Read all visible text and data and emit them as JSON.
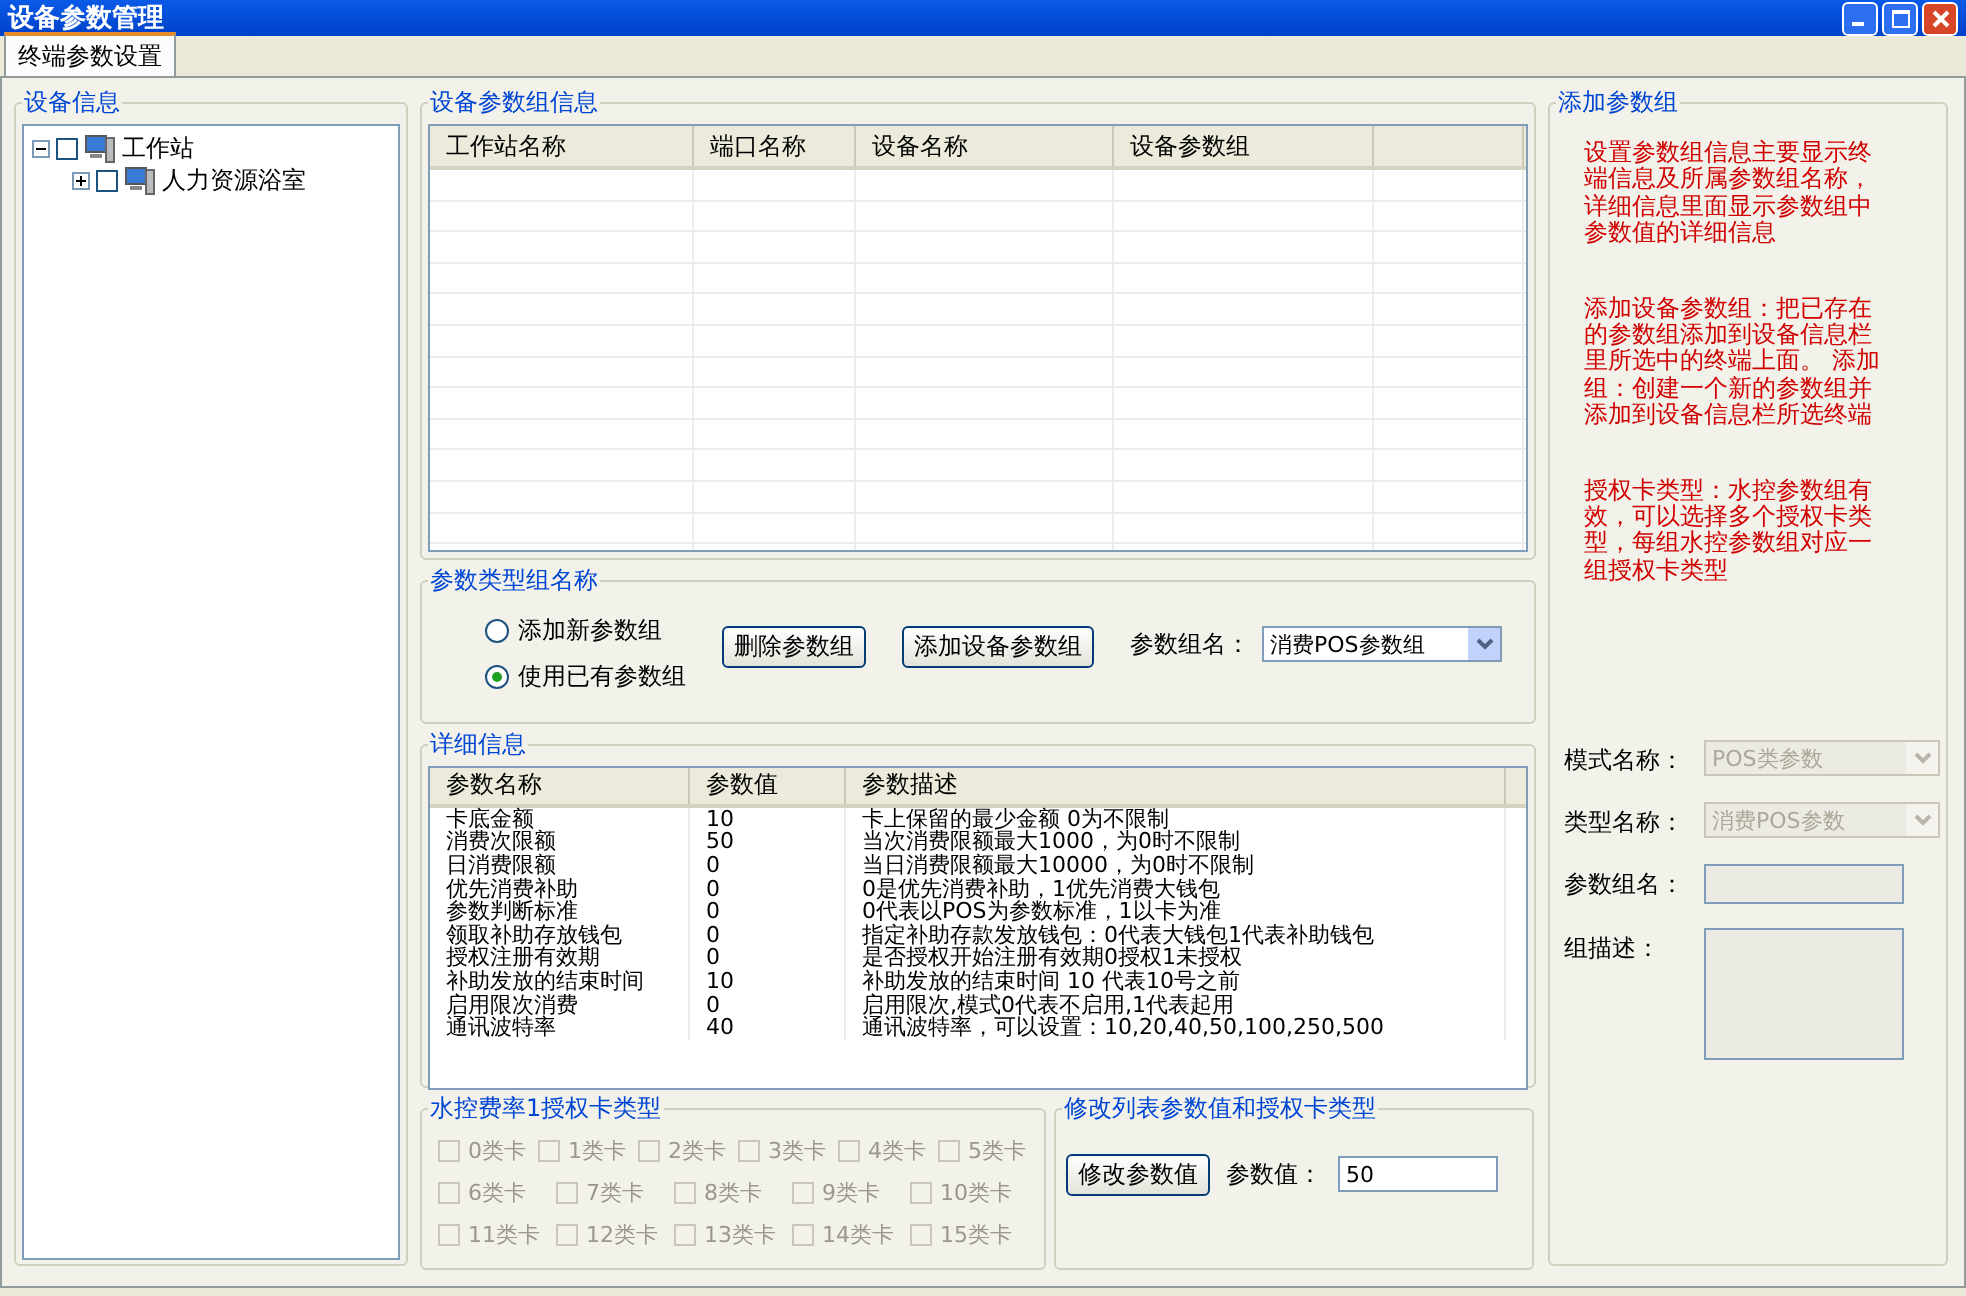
{
  "window": {
    "title": "设备参数管理"
  },
  "tabs": [
    {
      "label": "终端参数设置",
      "selected": true
    }
  ],
  "device_info": {
    "title": "设备信息",
    "tree": [
      {
        "label": "工作站",
        "expanded": true,
        "checked": false,
        "children": [
          {
            "label": "人力资源浴室",
            "expanded": false,
            "checked": false
          }
        ]
      }
    ]
  },
  "group_info": {
    "title": "设备参数组信息",
    "columns": [
      "工作站名称",
      "端口名称",
      "设备名称",
      "设备参数组"
    ]
  },
  "param_type": {
    "title": "参数类型组名称",
    "options": [
      {
        "label": "添加新参数组",
        "selected": false
      },
      {
        "label": "使用已有参数组",
        "selected": true
      }
    ],
    "buttons": [
      "删除参数组",
      "添加设备参数组"
    ],
    "group_label": "参数组名：",
    "group_value": "消费POS参数组"
  },
  "details": {
    "title": "详细信息",
    "columns": [
      "参数名称",
      "参数值",
      "参数描述"
    ],
    "rows": [
      {
        "name": "卡底金额",
        "value": "10",
        "description": "卡上保留的最少金额 0为不限制"
      },
      {
        "name": "消费次限额",
        "value": "50",
        "description": "当次消费限额最大1000，为0时不限制"
      },
      {
        "name": "日消费限额",
        "value": "0",
        "description": "当日消费限额最大10000，为0时不限制"
      },
      {
        "name": "优先消费补助",
        "value": "0",
        "description": "0是优先消费补助，1优先消费大钱包"
      },
      {
        "name": "参数判断标准",
        "value": "0",
        "description": "0代表以POS为参数标准，1以卡为准"
      },
      {
        "name": "领取补助存放钱包",
        "value": "0",
        "description": "指定补助存款发放钱包：0代表大钱包1代表补助钱包"
      },
      {
        "name": "授权注册有效期",
        "value": "0",
        "description": "是否授权开始注册有效期0授权1未授权"
      },
      {
        "name": "补助发放的结束时间",
        "value": "10",
        "description": "补助发放的结束时间 10 代表10号之前"
      },
      {
        "name": "启用限次消费",
        "value": "0",
        "description": "启用限次,模式0代表不启用,1代表起用"
      },
      {
        "name": "通讯波特率",
        "value": "40",
        "description": "通讯波特率，可以设置：10,20,40,50,100,250,500"
      }
    ]
  },
  "water_cards": {
    "title": "水控费率1授权卡类型",
    "disabled": true,
    "rows": [
      {
        "cards": [
          {
            "label": "0类卡",
            "checked": false
          },
          {
            "label": "1类卡",
            "checked": false
          },
          {
            "label": "2类卡",
            "checked": false
          },
          {
            "label": "3类卡",
            "checked": false
          },
          {
            "label": "4类卡",
            "checked": false
          },
          {
            "label": "5类卡",
            "checked": false
          }
        ]
      },
      {
        "cards": [
          {
            "label": "6类卡",
            "checked": false
          },
          {
            "label": "7类卡",
            "checked": false
          },
          {
            "label": "8类卡",
            "checked": false
          },
          {
            "label": "9类卡",
            "checked": false
          },
          {
            "label": "10类卡",
            "checked": false
          }
        ]
      },
      {
        "cards": [
          {
            "label": "11类卡",
            "checked": false
          },
          {
            "label": "12类卡",
            "checked": false
          },
          {
            "label": "13类卡",
            "checked": false
          },
          {
            "label": "14类卡",
            "checked": false
          },
          {
            "label": "15类卡",
            "checked": false
          }
        ]
      }
    ]
  },
  "modify": {
    "title": "修改列表参数值和授权卡类型",
    "button": "修改参数值",
    "value_label": "参数值：",
    "value": "50"
  },
  "add_group": {
    "title": "添加参数组",
    "notes": [
      "设置参数组信息主要显示终端信息及所属参数组名称，详细信息里面显示参数组中参数值的详细信息",
      "添加设备参数组：把已存在的参数组添加到设备信息栏里所选中的终端上面。 添加组：创建一个新的参数组并添加到设备信息栏所选终端",
      "授权卡类型：水控参数组有效，可以选择多个授权卡类型，每组水控参数组对应一组授权卡类型"
    ],
    "fields": [
      {
        "kind": "select",
        "label": "模式名称：",
        "value": "POS类参数",
        "disabled": true
      },
      {
        "kind": "select",
        "label": "类型名称：",
        "value": "消费POS参数",
        "disabled": true
      },
      {
        "kind": "input",
        "label": "参数组名："
      },
      {
        "kind": "textarea",
        "label": "组描述："
      }
    ]
  }
}
